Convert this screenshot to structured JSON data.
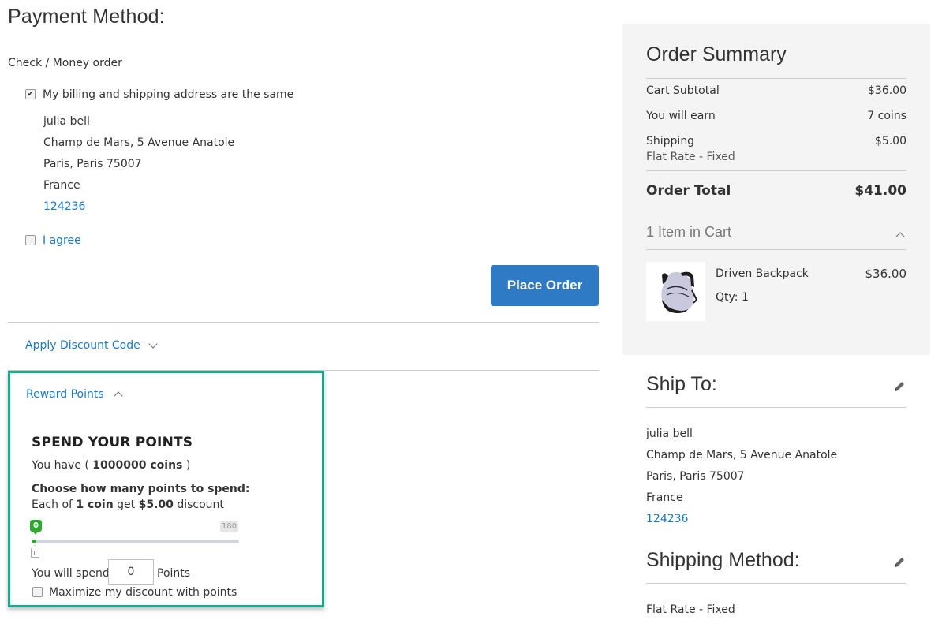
{
  "payment": {
    "title": "Payment Method:",
    "method": "Check / Money order",
    "billing_same_label": "My billing and shipping address are the same",
    "billing_same_checked": true,
    "address": {
      "name": "julia bell",
      "street": "Champ de Mars, 5 Avenue Anatole",
      "city_line": "Paris, Paris 75007",
      "country": "France",
      "phone": "124236"
    },
    "agree_label": "I agree",
    "agree_checked": false,
    "place_order_label": "Place Order"
  },
  "discount": {
    "toggle_label": "Apply Discount Code",
    "icon": "chevron-down-icon"
  },
  "reward": {
    "toggle_label": "Reward Points",
    "icon": "chevron-up-icon",
    "title": "SPEND YOUR POINTS",
    "you_have_prefix": "You have ( ",
    "you_have_value": "1000000 coins",
    "you_have_suffix": " )",
    "choose_label": "Choose how many points to spend:",
    "each_prefix": "Each of ",
    "each_coin": "1 coin",
    "each_mid": " get ",
    "each_amount": "$5.00",
    "each_suffix": " discount",
    "slider": {
      "min": 0,
      "max": 180,
      "value": 0,
      "min_label": "0",
      "max_label": "180"
    },
    "spend_prefix": "You will spend",
    "spend_value": "0",
    "spend_suffix": "Points",
    "maximize_label": "Maximize my discount with points",
    "maximize_checked": false,
    "highlight_color": "#17a98b"
  },
  "summary": {
    "title": "Order Summary",
    "rows": [
      {
        "label": "Cart Subtotal",
        "value": "$36.00"
      },
      {
        "label": "You will earn",
        "value": "7 coins"
      },
      {
        "label": "Shipping",
        "value": "$5.00",
        "sub": "Flat Rate - Fixed"
      }
    ],
    "total_label": "Order Total",
    "total_value": "$41.00",
    "items_toggle": "1 Item in Cart",
    "items": [
      {
        "name": "Driven Backpack",
        "qty": "Qty: 1",
        "price": "$36.00"
      }
    ]
  },
  "ship_to": {
    "title": "Ship To:",
    "name": "julia bell",
    "street": "Champ de Mars, 5 Avenue Anatole",
    "city_line": "Paris, Paris 75007",
    "country": "France",
    "phone": "124236"
  },
  "shipping_method": {
    "title": "Shipping Method:",
    "value": "Flat Rate - Fixed"
  },
  "colors": {
    "accent": "#2e7ac4",
    "link": "#1979c3",
    "slider_active": "#2ea82e",
    "summary_bg": "#f4f4f4"
  }
}
